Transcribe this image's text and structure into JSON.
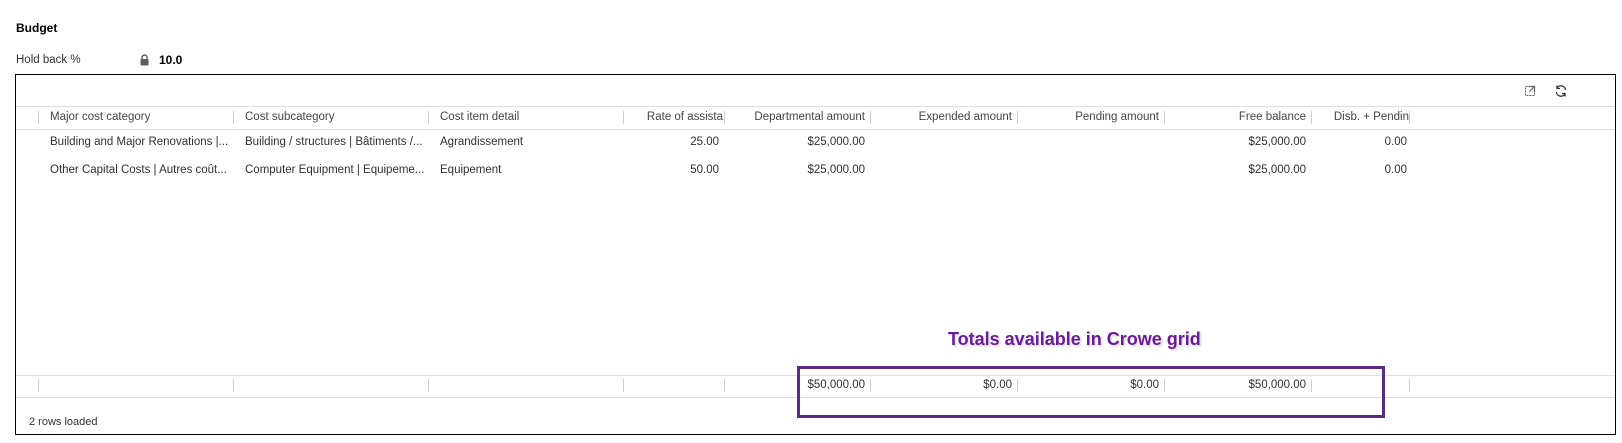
{
  "section": {
    "title": "Budget"
  },
  "holdback": {
    "label": "Hold back %",
    "value": "10.0",
    "icon": "lock-icon"
  },
  "toolbar": {
    "expand_icon": "expand-icon",
    "refresh_icon": "refresh-icon"
  },
  "columns": [
    "Major cost category",
    "Cost subcategory",
    "Cost item detail",
    "Rate of assista",
    "Departmental amount",
    "Expended amount",
    "Pending amount",
    "Free balance",
    "Disb. + Pendin"
  ],
  "rows": [
    {
      "major": "Building and Major Renovations |...",
      "sub": "Building / structures | Bâtiments /...",
      "detail": "Agrandissement",
      "rate": "25.00",
      "departmental": "$25,000.00",
      "expended": "",
      "pending": "",
      "free": "$25,000.00",
      "disb": "0.00"
    },
    {
      "major": "Other Capital Costs | Autres coût...",
      "sub": "Computer Equipment | Équipeme...",
      "detail": "Équipement",
      "rate": "50.00",
      "departmental": "$25,000.00",
      "expended": "",
      "pending": "",
      "free": "$25,000.00",
      "disb": "0.00"
    }
  ],
  "totals": {
    "departmental": "$50,000.00",
    "expended": "$0.00",
    "pending": "$0.00",
    "free": "$50,000.00"
  },
  "status": "2 rows loaded",
  "annotation": {
    "text": "Totals available in Crowe grid",
    "color": "#5b2a86"
  }
}
